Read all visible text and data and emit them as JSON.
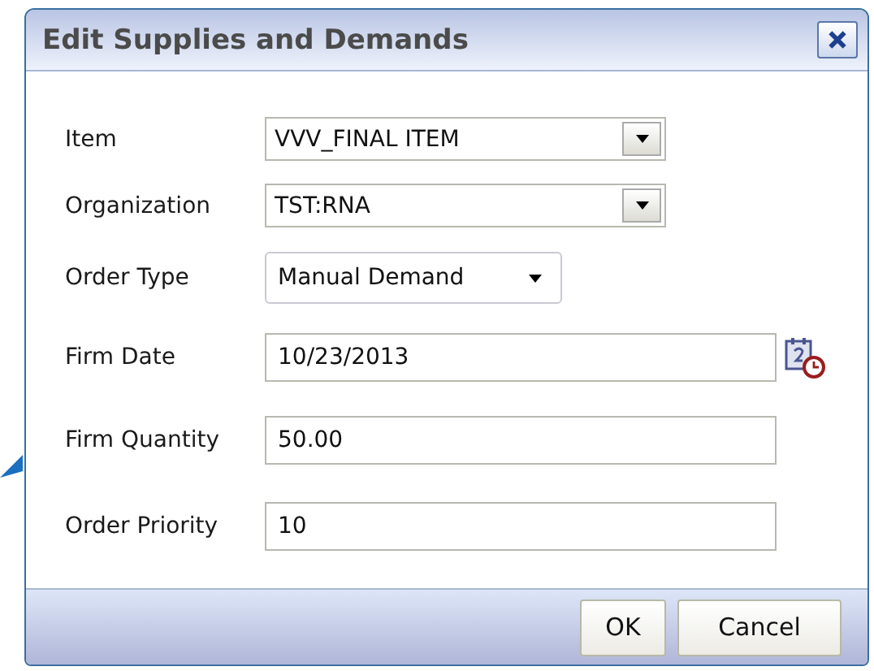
{
  "dialog": {
    "title": "Edit Supplies and Demands"
  },
  "fields": [
    {
      "kind": "select",
      "label": "Item",
      "value": "VVV_FINAL ITEM"
    },
    {
      "kind": "select",
      "label": "Organization",
      "value": "TST:RNA"
    },
    {
      "kind": "dropdown",
      "label": "Order Type",
      "value": "Manual Demand"
    },
    {
      "kind": "date",
      "label": "Firm Date",
      "value": "10/23/2013"
    },
    {
      "kind": "text",
      "label": "Firm Quantity",
      "value": "50.00"
    },
    {
      "kind": "text",
      "label": "Order Priority",
      "value": "10"
    }
  ],
  "buttons": [
    "OK",
    "Cancel"
  ]
}
